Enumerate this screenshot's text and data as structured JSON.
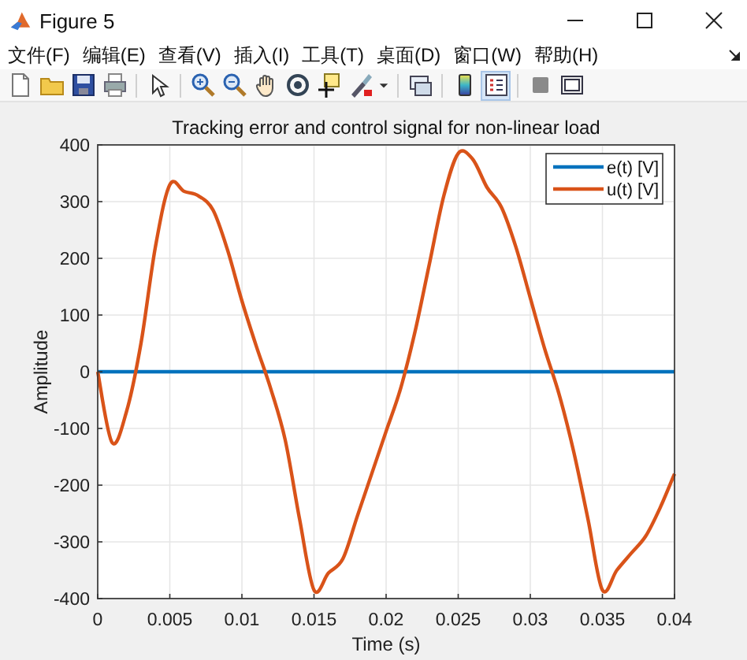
{
  "window": {
    "title": "Figure 5"
  },
  "menu": [
    "文件(F)",
    "编辑(E)",
    "查看(V)",
    "插入(I)",
    "工具(T)",
    "桌面(D)",
    "窗口(W)",
    "帮助(H)"
  ],
  "toolbar": [
    {
      "kind": "new",
      "pressed": false
    },
    {
      "kind": "open",
      "pressed": false
    },
    {
      "kind": "save",
      "pressed": false
    },
    {
      "kind": "print",
      "pressed": false
    },
    {
      "kind": "sep"
    },
    {
      "kind": "pointer",
      "pressed": false
    },
    {
      "kind": "sep"
    },
    {
      "kind": "zoom-in",
      "pressed": false
    },
    {
      "kind": "zoom-out",
      "pressed": false
    },
    {
      "kind": "pan",
      "pressed": false
    },
    {
      "kind": "rotate",
      "pressed": false
    },
    {
      "kind": "cursor",
      "pressed": false
    },
    {
      "kind": "brush",
      "pressed": false
    },
    {
      "kind": "caret"
    },
    {
      "kind": "sep"
    },
    {
      "kind": "link",
      "pressed": false
    },
    {
      "kind": "sep"
    },
    {
      "kind": "colorbar",
      "pressed": false
    },
    {
      "kind": "legend",
      "pressed": true
    },
    {
      "kind": "sep"
    },
    {
      "kind": "hide",
      "pressed": false
    },
    {
      "kind": "show",
      "pressed": false
    }
  ],
  "figure": {
    "chart_data": {
      "type": "line",
      "title": "Tracking error and control signal for non-linear load",
      "xlabel": "Time (s)",
      "ylabel": "Amplitude",
      "x": [
        0,
        0.001,
        0.002,
        0.003,
        0.004,
        0.005,
        0.006,
        0.007,
        0.008,
        0.009,
        0.01,
        0.011,
        0.012,
        0.013,
        0.014,
        0.015,
        0.016,
        0.017,
        0.018,
        0.019,
        0.02,
        0.021,
        0.022,
        0.023,
        0.024,
        0.025,
        0.026,
        0.027,
        0.028,
        0.029,
        0.03,
        0.031,
        0.032,
        0.033,
        0.034,
        0.035,
        0.036,
        0.037,
        0.038,
        0.039,
        0.04
      ],
      "series": [
        {
          "name": "e(t) [V]",
          "color": "#0072bd",
          "values": [
            0,
            0,
            0,
            0,
            0,
            0,
            0,
            0,
            0,
            0,
            0,
            0,
            0,
            0,
            0,
            0,
            0,
            0,
            0,
            0,
            0,
            0,
            0,
            0,
            0,
            0,
            0,
            0,
            0,
            0,
            0,
            0,
            0,
            0,
            0,
            0,
            0,
            0,
            0,
            0,
            0
          ]
        },
        {
          "name": "u(t) [V]",
          "color": "#d95319",
          "values": [
            0,
            -125,
            -70,
            50,
            220,
            330,
            318,
            310,
            285,
            215,
            125,
            45,
            -30,
            -120,
            -260,
            -385,
            -355,
            -330,
            -255,
            -180,
            -105,
            -30,
            70,
            190,
            310,
            385,
            375,
            325,
            290,
            220,
            130,
            40,
            -40,
            -140,
            -260,
            -385,
            -350,
            -320,
            -290,
            -240,
            -180
          ]
        }
      ],
      "xlim": [
        0,
        0.04
      ],
      "ylim": [
        -400,
        400
      ],
      "xticks": [
        0,
        0.005,
        0.01,
        0.015,
        0.02,
        0.025,
        0.03,
        0.035,
        0.04
      ],
      "yticks": [
        -400,
        -300,
        -200,
        -100,
        0,
        100,
        200,
        300,
        400
      ],
      "grid": true,
      "legend": true
    }
  }
}
